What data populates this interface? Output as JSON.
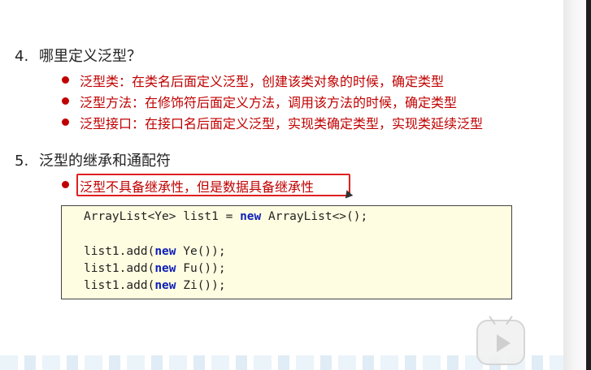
{
  "section4": {
    "number": "4.",
    "title": "哪里定义泛型？",
    "bullets": [
      "泛型类：在类名后面定义泛型，创建该类对象的时候，确定类型",
      "泛型方法：在修饰符后面定义方法，调用该方法的时候，确定类型",
      "泛型接口：在接口名后面定义泛型，实现类确定类型，实现类延续泛型"
    ]
  },
  "section5": {
    "number": "5.",
    "title": "泛型的继承和通配符",
    "bullets": [
      "泛型不具备继承性，但是数据具备继承性"
    ]
  },
  "code": {
    "line1_a": "ArrayList<Ye> list1 = ",
    "line1_kw": "new",
    "line1_b": " ArrayList<>();",
    "line2_a": "list1.add(",
    "line2_kw": "new",
    "line2_b": " Ye());",
    "line3_a": "list1.add(",
    "line3_kw": "new",
    "line3_b": " Fu());",
    "line4_a": "list1.add(",
    "line4_kw": "new",
    "line4_b": " Zi());"
  },
  "colors": {
    "bullet_text": "#c00000",
    "highlight_border": "#e0201f",
    "code_bg": "#fffde1",
    "keyword": "#0d1fb8"
  },
  "player": {
    "play_icon": "play-icon"
  }
}
